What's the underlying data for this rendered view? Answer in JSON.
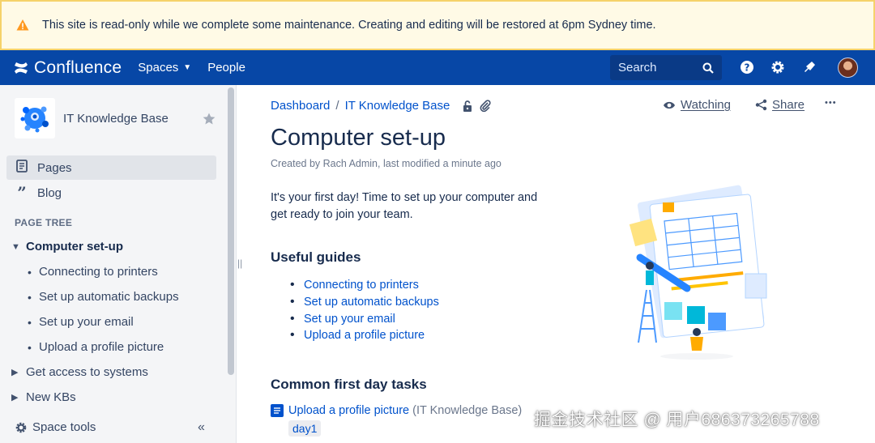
{
  "banner": {
    "text": "This site is read-only while we complete some maintenance. Creating and editing will be restored at 6pm Sydney time.",
    "icon": "warning-icon",
    "color": "#fffae6"
  },
  "topnav": {
    "logo_text": "Confluence",
    "spaces_label": "Spaces",
    "people_label": "People",
    "search_placeholder": "Search",
    "icons": [
      "help-icon",
      "gear-icon",
      "notifications-icon",
      "avatar"
    ],
    "color": "#0747a6"
  },
  "sidebar": {
    "space_name": "IT Knowledge Base",
    "items": [
      {
        "label": "Pages",
        "icon": "pages-icon",
        "active": true
      },
      {
        "label": "Blog",
        "icon": "blog-quote-icon",
        "active": false
      }
    ],
    "section_label": "PAGE TREE",
    "tree": {
      "current": "Computer set-up",
      "children": [
        "Connecting to printers",
        "Set up automatic backups",
        "Set up your email",
        "Upload a profile picture"
      ],
      "siblings": [
        "Get access to systems",
        "New KBs"
      ]
    },
    "space_tools": "Space tools",
    "collapse_glyph": "«"
  },
  "main": {
    "breadcrumb": [
      "Dashboard",
      "IT Knowledge Base"
    ],
    "watching_label": "Watching",
    "share_label": "Share",
    "more_label": "•••",
    "title": "Computer set-up",
    "byline": "Created by Rach Admin, last modified a minute ago",
    "intro": "It's your first day!  Time to set up your computer and get ready to join your team.",
    "guides_heading": "Useful guides",
    "guides": [
      "Connecting to printers",
      "Set up automatic backups",
      "Set up your email",
      "Upload a profile picture"
    ],
    "tasks_heading": "Common first day tasks",
    "task": {
      "link": "Upload a profile picture",
      "space": "(IT Knowledge Base)",
      "label": "day1"
    }
  },
  "watermark": "掘金技术社区 @ 用户686373265788",
  "colors": {
    "link": "#0052cc",
    "text": "#172b4d",
    "sidebar_bg": "#f4f5f7"
  }
}
